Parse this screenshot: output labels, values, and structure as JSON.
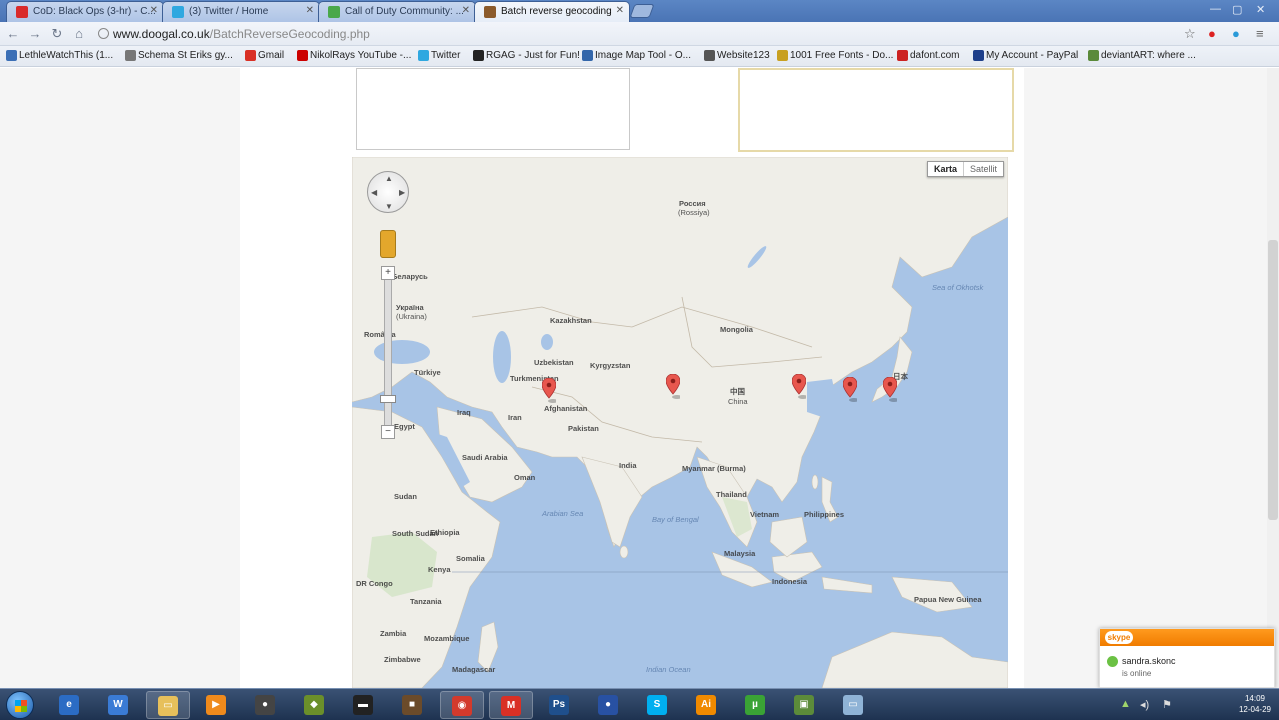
{
  "browser": {
    "tabs": [
      {
        "label": "CoD: Black Ops (3-hr) - C...",
        "favicon_color": "#d92b2b"
      },
      {
        "label": "(3) Twitter / Home",
        "favicon_color": "#2fa8e0"
      },
      {
        "label": "Call of Duty Community: ...",
        "favicon_color": "#4aa84a"
      },
      {
        "label": "Batch reverse geocoding",
        "favicon_color": "#8b5a2b"
      }
    ],
    "url_host": "www.doogal.co.uk",
    "url_path": "/BatchReverseGeocoding.php"
  },
  "bookmarks": [
    {
      "label": "LethleWatchThis (1...",
      "color": "#3b6fb6"
    },
    {
      "label": "Schema St Eriks gy...",
      "color": "#777777"
    },
    {
      "label": "Gmail",
      "color": "#d93025"
    },
    {
      "label": "NikolRays YouTube -...",
      "color": "#cc0000"
    },
    {
      "label": "Twitter",
      "color": "#2fa8e0"
    },
    {
      "label": "RGAG - Just for Fun!",
      "color": "#222222"
    },
    {
      "label": "Image Map Tool - O...",
      "color": "#3366aa"
    },
    {
      "label": "Website123",
      "color": "#555555"
    },
    {
      "label": "1001 Free Fonts - Do...",
      "color": "#c8a020"
    },
    {
      "label": "dafont.com",
      "color": "#cc2222"
    },
    {
      "label": "My Account - PayPal",
      "color": "#1e3f8a"
    },
    {
      "label": "deviantART: where ...",
      "color": "#5a8a3a"
    }
  ],
  "map": {
    "map_type_buttons": {
      "map": "Karta",
      "satellite": "Satellit"
    },
    "labels": {
      "russia": "Россия",
      "russia_sub": "(Rossiya)",
      "kazakhstan": "Kazakhstan",
      "mongolia": "Mongolia",
      "china": "中国",
      "china_sub": "China",
      "uzbekistan": "Uzbekistan",
      "kyrgyzstan": "Kyrgyzstan",
      "turkmenistan": "Turkmenistan",
      "afghanistan": "Afghanistan",
      "pakistan": "Pakistan",
      "india": "India",
      "iran": "Iran",
      "iraq": "Iraq",
      "turkiye": "Türkiye",
      "ukraine": "Україна",
      "ukraine_sub": "(Ukraina)",
      "romania": "România",
      "belarus": "Беларусь",
      "saudi": "Saudi Arabia",
      "oman": "Oman",
      "egypt": "Egypt",
      "sudan": "Sudan",
      "south_sudan": "South Sudan",
      "ethiopia": "Ethiopia",
      "somalia": "Somalia",
      "kenya": "Kenya",
      "tanzania": "Tanzania",
      "zambia": "Zambia",
      "dr_congo": "DR Congo",
      "zimbabwe": "Zimbabwe",
      "mozambique": "Mozambique",
      "madagascar": "Madagascar",
      "myanmar": "Myanmar (Burma)",
      "thailand": "Thailand",
      "vietnam": "Vietnam",
      "philippines": "Philippines",
      "malaysia": "Malaysia",
      "indonesia": "Indonesia",
      "papua": "Papua New Guinea",
      "japan": "日本",
      "india_ocean": "Indian Ocean",
      "sea_okhotsk": "Sea of Okhotsk",
      "bay_bengal": "Bay of Bengal",
      "arabian_sea": "Arabian Sea"
    }
  },
  "skype": {
    "brand": "skype",
    "contact_name": "sandra.skonc",
    "status": "is online"
  },
  "taskbar": {
    "apps": [
      {
        "name": "ie",
        "glyph": "e",
        "color": "#2b6cc4"
      },
      {
        "name": "app2",
        "glyph": "W",
        "color": "#3a7bd5"
      },
      {
        "name": "explorer",
        "glyph": "▭",
        "color": "#e7c05b"
      },
      {
        "name": "media",
        "glyph": "▶",
        "color": "#ef8a1c"
      },
      {
        "name": "app5",
        "glyph": "●",
        "color": "#444444"
      },
      {
        "name": "app6",
        "glyph": "◆",
        "color": "#6b8f2a"
      },
      {
        "name": "cmd",
        "glyph": "▬",
        "color": "#222222"
      },
      {
        "name": "minecraft",
        "glyph": "■",
        "color": "#6b4b2a"
      },
      {
        "name": "chrome",
        "glyph": "◉",
        "color": "#d33a2c"
      },
      {
        "name": "gmail",
        "glyph": "M",
        "color": "#d93025"
      },
      {
        "name": "photoshop",
        "glyph": "Ps",
        "color": "#1f4f8c"
      },
      {
        "name": "app12",
        "glyph": "●",
        "color": "#2851a3"
      },
      {
        "name": "skype",
        "glyph": "S",
        "color": "#00aff0"
      },
      {
        "name": "illustrator",
        "glyph": "Ai",
        "color": "#f08a00"
      },
      {
        "name": "utorrent",
        "glyph": "µ",
        "color": "#3aa335"
      },
      {
        "name": "app16",
        "glyph": "▣",
        "color": "#5c8b3a"
      },
      {
        "name": "app17",
        "glyph": "▭",
        "color": "#8fb3d6"
      }
    ],
    "time": "14:09",
    "date": "12-04-29"
  }
}
